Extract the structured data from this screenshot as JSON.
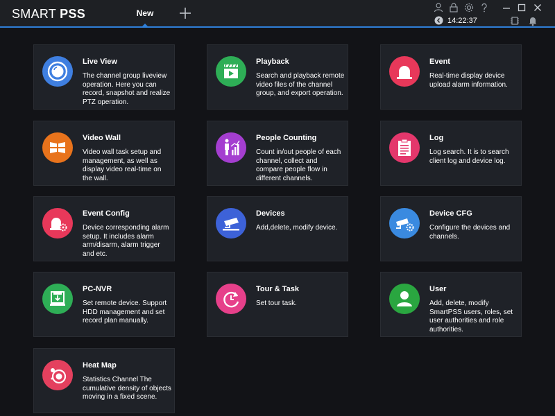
{
  "app": {
    "logo_light": "SMART",
    "logo_bold": "PSS",
    "tab_label": "New",
    "clock": "14:22:37"
  },
  "colors": {
    "accent": "#2f7fd8",
    "background": "#121317",
    "card": "#1f2228"
  },
  "cards": [
    {
      "title": "Live View",
      "desc": "The channel group liveview operation. Here you can record, snapshot and realize PTZ operation.",
      "color": "#3f7fe0",
      "icon": "camera-lens-icon"
    },
    {
      "title": "Playback",
      "desc": "Search and playback remote video files of the channel group, and export operation.",
      "color": "#2eae56",
      "icon": "clapperboard-icon"
    },
    {
      "title": "Event",
      "desc": "Real-time display device upload alarm information.",
      "color": "#e8385a",
      "icon": "alarm-siren-icon"
    },
    {
      "title": "Video Wall",
      "desc": "Video wall task setup and management, as well as display video real-time on the wall.",
      "color": "#e8731c",
      "icon": "video-wall-icon"
    },
    {
      "title": "People Counting",
      "desc": "Count in/out people of each channel, collect and compare people flow in different channels.",
      "color": "#a43ed0",
      "icon": "people-chart-icon"
    },
    {
      "title": "Log",
      "desc": "Log search. It is to search client log and device log.",
      "color": "#e4376c",
      "icon": "clipboard-icon"
    },
    {
      "title": "Event Config",
      "desc": "Device corresponding alarm setup. It includes alarm arm/disarm, alarm trigger and etc.",
      "color": "#e8385a",
      "icon": "alarm-gear-icon"
    },
    {
      "title": "Devices",
      "desc": "Add,delete, modify device.",
      "color": "#3d62d8",
      "icon": "cctv-camera-icon"
    },
    {
      "title": "Device CFG",
      "desc": "Configure the devices and channels.",
      "color": "#3a8ae0",
      "icon": "camera-gear-icon"
    },
    {
      "title": "PC-NVR",
      "desc": "Set remote device. Support HDD management and set record plan manually.",
      "color": "#2eae56",
      "icon": "recorder-download-icon"
    },
    {
      "title": "Tour & Task",
      "desc": "Set tour task.",
      "color": "#e6408a",
      "icon": "cycle-clock-icon"
    },
    {
      "title": "User",
      "desc": "Add, delete, modify SmartPSS users, roles, set user authorities and role authorities.",
      "color": "#2aa640",
      "icon": "user-icon"
    },
    {
      "title": "Heat Map",
      "desc": "Statistics Channel The cumulative density of objects moving in a fixed scene.",
      "color": "#e4405e",
      "icon": "heat-target-icon"
    }
  ]
}
